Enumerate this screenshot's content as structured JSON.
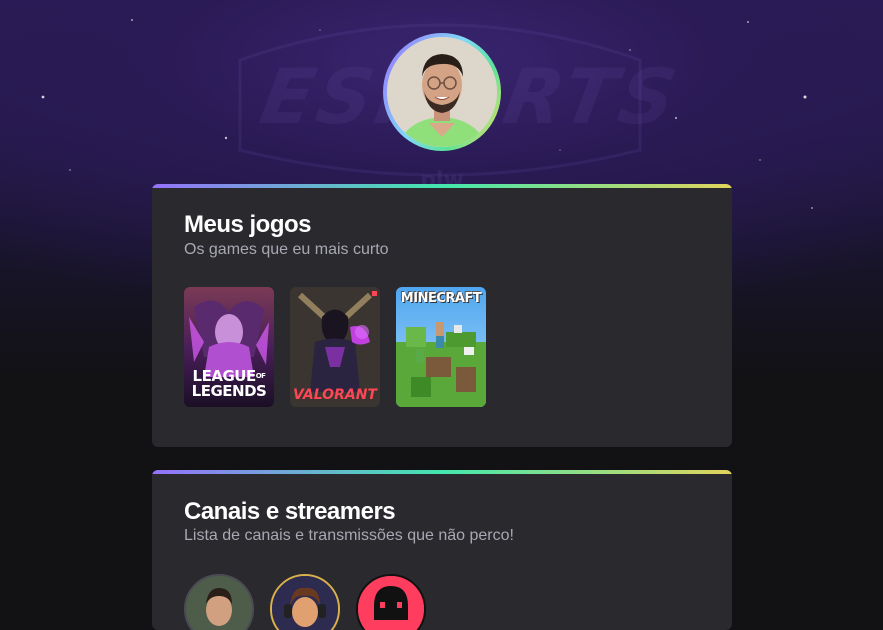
{
  "profile": {
    "avatar_icon": "profile-photo-icon"
  },
  "background": {
    "watermark_text": "ESPORTS",
    "watermark_sub": "plw"
  },
  "games_section": {
    "title": "Meus jogos",
    "subtitle": "Os games que eu mais curto",
    "games": [
      {
        "name_line1": "LEAGUE",
        "name_of": "OF",
        "name_line2": "LEGENDS"
      },
      {
        "name": "VALORANT"
      },
      {
        "name": "MINECRAFT"
      }
    ]
  },
  "channels_section": {
    "title": "Canais e streamers",
    "subtitle": "Lista de canais e transmissões que não perco!"
  },
  "colors": {
    "card_bg": "#29292e",
    "title": "#ffffff",
    "subtitle": "#a8a8b3",
    "gradient": [
      "#9572fc",
      "#43e7ad",
      "#e2d45c"
    ]
  }
}
